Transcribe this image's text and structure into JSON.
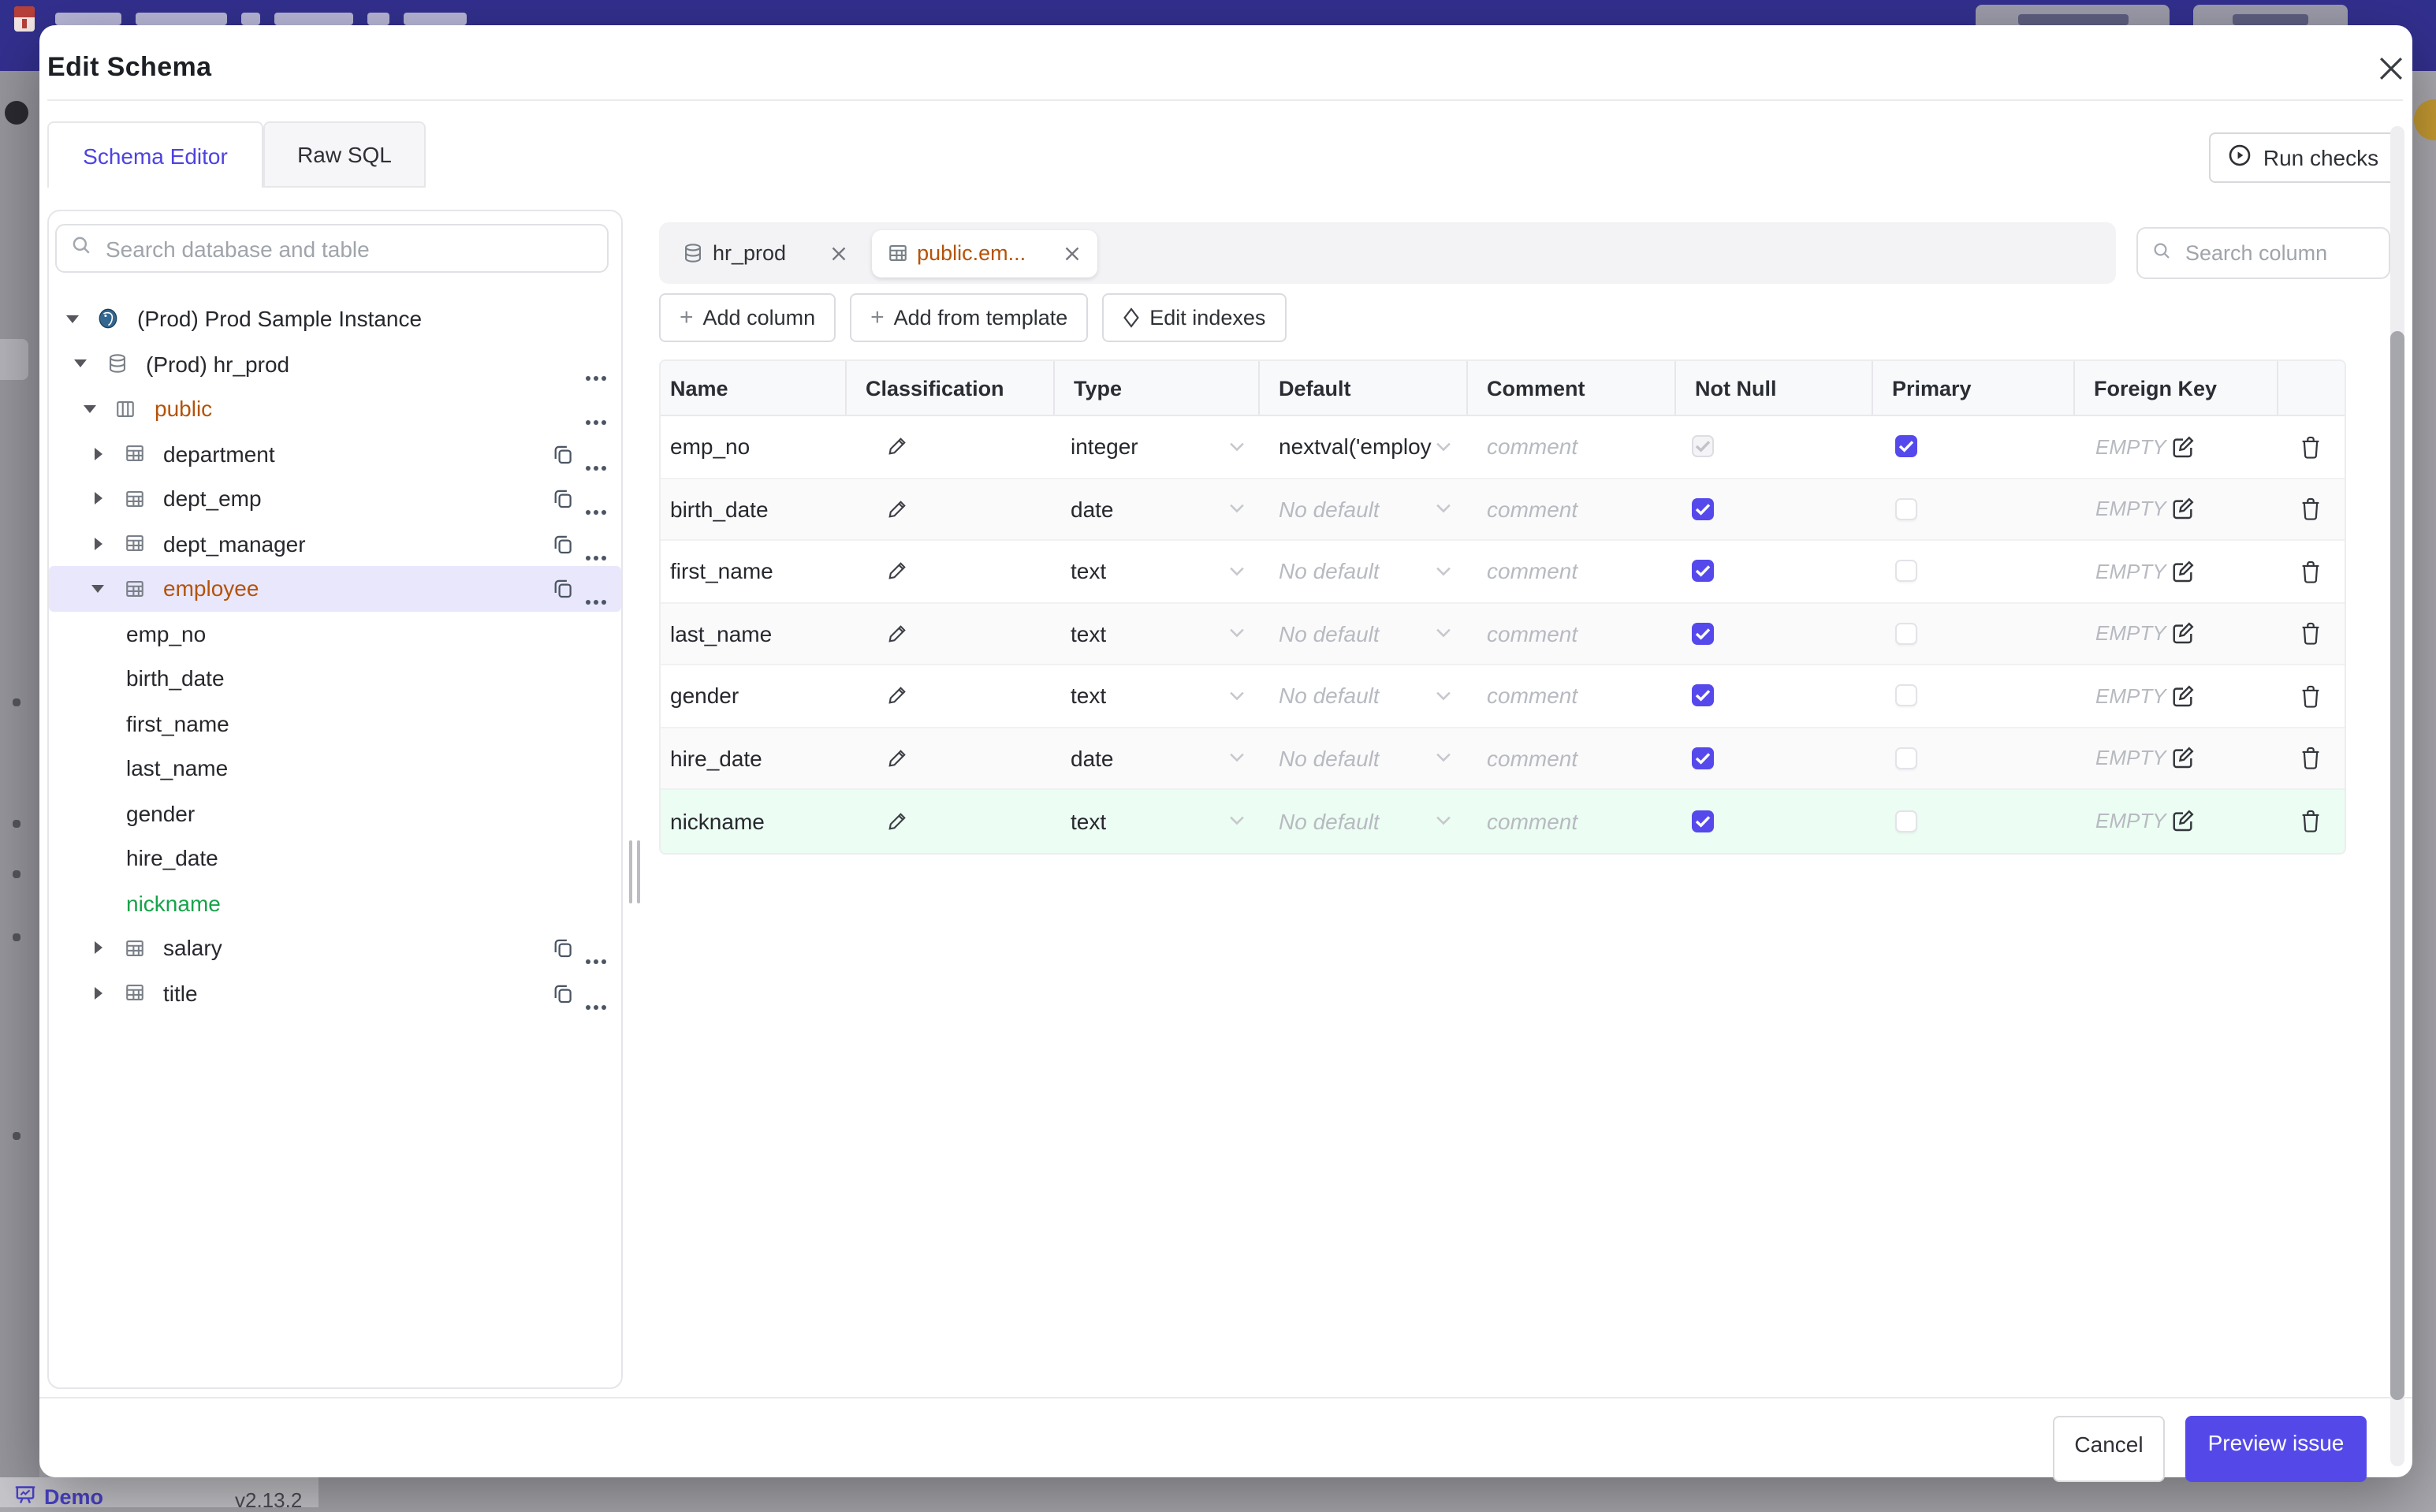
{
  "colors": {
    "accent": "#5549ec",
    "amber": "#b45309",
    "green": "#16a34a",
    "selected_bg": "#e9e7fc",
    "green_row_bg": "#ecfdf3"
  },
  "backdrop": {
    "demo_label": "Demo",
    "app_version": "v2.13.2"
  },
  "dialog": {
    "title": "Edit Schema",
    "tabs": [
      {
        "label": "Schema Editor",
        "active": true
      },
      {
        "label": "Raw SQL",
        "active": false
      }
    ],
    "run_checks_label": "Run checks",
    "footer": {
      "cancel_label": "Cancel",
      "primary_label": "Preview issue"
    }
  },
  "sidebar": {
    "search_placeholder": "Search database and table",
    "tree": [
      {
        "label": "(Prod) Prod Sample Instance",
        "kind": "instance",
        "level": 0,
        "caret": "down",
        "icon": "postgres"
      },
      {
        "label": "(Prod) hr_prod",
        "kind": "database",
        "level": 1,
        "caret": "down",
        "icon": "database",
        "menu": true
      },
      {
        "label": "public",
        "kind": "schema",
        "level": 2,
        "caret": "down",
        "icon": "schema",
        "menu": true,
        "highlight": "amber"
      },
      {
        "label": "department",
        "kind": "table",
        "level": 3,
        "caret": "right",
        "icon": "table",
        "copy": true,
        "menu": true
      },
      {
        "label": "dept_emp",
        "kind": "table",
        "level": 3,
        "caret": "right",
        "icon": "table",
        "copy": true,
        "menu": true
      },
      {
        "label": "dept_manager",
        "kind": "table",
        "level": 3,
        "caret": "right",
        "icon": "table",
        "copy": true,
        "menu": true
      },
      {
        "label": "employee",
        "kind": "table",
        "level": 3,
        "caret": "down",
        "icon": "table",
        "copy": true,
        "menu": true,
        "selected": true,
        "highlight": "amber"
      },
      {
        "label": "emp_no",
        "kind": "column",
        "level": 4
      },
      {
        "label": "birth_date",
        "kind": "column",
        "level": 4
      },
      {
        "label": "first_name",
        "kind": "column",
        "level": 4
      },
      {
        "label": "last_name",
        "kind": "column",
        "level": 4
      },
      {
        "label": "gender",
        "kind": "column",
        "level": 4
      },
      {
        "label": "hire_date",
        "kind": "column",
        "level": 4
      },
      {
        "label": "nickname",
        "kind": "column",
        "level": 4,
        "highlight": "green"
      },
      {
        "label": "salary",
        "kind": "table",
        "level": 3,
        "caret": "right",
        "icon": "table",
        "copy": true,
        "menu": true
      },
      {
        "label": "title",
        "kind": "table",
        "level": 3,
        "caret": "right",
        "icon": "table",
        "copy": true,
        "menu": true
      }
    ]
  },
  "main": {
    "tabs": [
      {
        "label": "hr_prod",
        "icon": "database",
        "active": false
      },
      {
        "label": "public.em...",
        "icon": "table",
        "active": true,
        "highlight": "amber"
      }
    ],
    "toolbar": [
      {
        "icon": "plus",
        "label": "Add column"
      },
      {
        "icon": "plus",
        "label": "Add from template"
      },
      {
        "icon": "diamond",
        "label": "Edit indexes"
      }
    ],
    "search_placeholder": "Search column",
    "table": {
      "headers": [
        "Name",
        "Classification",
        "Type",
        "Default",
        "Comment",
        "Not Null",
        "Primary",
        "Foreign Key"
      ],
      "comment_placeholder": "comment",
      "foreign_key_empty": "EMPTY",
      "no_default_label": "No default",
      "rows": [
        {
          "name": "emp_no",
          "type": "integer",
          "default": "nextval('employ",
          "default_muted": false,
          "not_null": "checked-disabled",
          "primary": "checked"
        },
        {
          "name": "birth_date",
          "type": "date",
          "default": "No default",
          "default_muted": true,
          "not_null": "checked",
          "primary": "unchecked"
        },
        {
          "name": "first_name",
          "type": "text",
          "default": "No default",
          "default_muted": true,
          "not_null": "checked",
          "primary": "unchecked"
        },
        {
          "name": "last_name",
          "type": "text",
          "default": "No default",
          "default_muted": true,
          "not_null": "checked",
          "primary": "unchecked"
        },
        {
          "name": "gender",
          "type": "text",
          "default": "No default",
          "default_muted": true,
          "not_null": "checked",
          "primary": "unchecked"
        },
        {
          "name": "hire_date",
          "type": "date",
          "default": "No default",
          "default_muted": true,
          "not_null": "checked",
          "primary": "unchecked"
        },
        {
          "name": "nickname",
          "type": "text",
          "default": "No default",
          "default_muted": true,
          "not_null": "checked",
          "primary": "unchecked",
          "row_highlight": "green"
        }
      ]
    }
  }
}
